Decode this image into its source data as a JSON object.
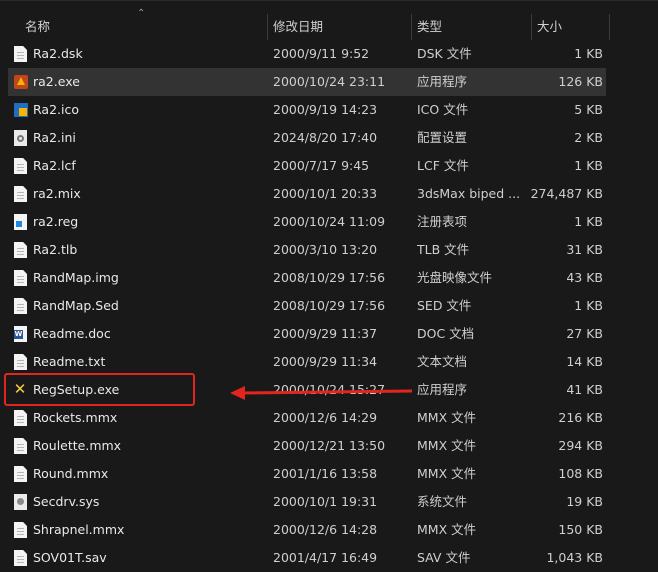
{
  "columns": {
    "name": "名称",
    "date": "修改日期",
    "type": "类型",
    "size": "大小"
  },
  "files": [
    {
      "name": "Ra2.dsk",
      "date": "2000/9/11 9:52",
      "type": "DSK 文件",
      "size": "1 KB",
      "icon": "file-icon"
    },
    {
      "name": "ra2.exe",
      "date": "2000/10/24 23:11",
      "type": "应用程序",
      "size": "126 KB",
      "icon": "ra2-app-icon"
    },
    {
      "name": "Ra2.ico",
      "date": "2000/9/19 14:23",
      "type": "ICO 文件",
      "size": "5 KB",
      "icon": "ico-file-icon"
    },
    {
      "name": "Ra2.ini",
      "date": "2024/8/20 17:40",
      "type": "配置设置",
      "size": "2 KB",
      "icon": "settings-file-icon"
    },
    {
      "name": "Ra2.lcf",
      "date": "2000/7/17 9:45",
      "type": "LCF 文件",
      "size": "1 KB",
      "icon": "file-icon"
    },
    {
      "name": "ra2.mix",
      "date": "2000/10/1 20:33",
      "type": "3dsMax biped ...",
      "size": "274,487 KB",
      "icon": "file-icon"
    },
    {
      "name": "ra2.reg",
      "date": "2000/10/24 11:09",
      "type": "注册表项",
      "size": "1 KB",
      "icon": "registry-file-icon"
    },
    {
      "name": "Ra2.tlb",
      "date": "2000/3/10 13:20",
      "type": "TLB 文件",
      "size": "31 KB",
      "icon": "file-icon"
    },
    {
      "name": "RandMap.img",
      "date": "2008/10/29 17:56",
      "type": "光盘映像文件",
      "size": "43 KB",
      "icon": "file-icon"
    },
    {
      "name": "RandMap.Sed",
      "date": "2008/10/29 17:56",
      "type": "SED 文件",
      "size": "1 KB",
      "icon": "file-icon"
    },
    {
      "name": "Readme.doc",
      "date": "2000/9/29 11:37",
      "type": "DOC 文档",
      "size": "27 KB",
      "icon": "word-doc-icon"
    },
    {
      "name": "Readme.txt",
      "date": "2000/9/29 11:34",
      "type": "文本文档",
      "size": "14 KB",
      "icon": "text-file-icon"
    },
    {
      "name": "RegSetup.exe",
      "date": "2000/10/24 15:27",
      "type": "应用程序",
      "size": "41 KB",
      "icon": "setup-app-icon"
    },
    {
      "name": "Rockets.mmx",
      "date": "2000/12/6 14:29",
      "type": "MMX 文件",
      "size": "216 KB",
      "icon": "file-icon"
    },
    {
      "name": "Roulette.mmx",
      "date": "2000/12/21 13:50",
      "type": "MMX 文件",
      "size": "294 KB",
      "icon": "file-icon"
    },
    {
      "name": "Round.mmx",
      "date": "2001/1/16 13:58",
      "type": "MMX 文件",
      "size": "108 KB",
      "icon": "file-icon"
    },
    {
      "name": "Secdrv.sys",
      "date": "2000/10/1 19:31",
      "type": "系统文件",
      "size": "19 KB",
      "icon": "system-file-icon"
    },
    {
      "name": "Shrapnel.mmx",
      "date": "2000/12/6 14:28",
      "type": "MMX 文件",
      "size": "150 KB",
      "icon": "file-icon"
    },
    {
      "name": "SOV01T.sav",
      "date": "2001/4/17 16:49",
      "type": "SAV 文件",
      "size": "1,043 KB",
      "icon": "file-icon"
    }
  ],
  "selected_file": "ra2.exe",
  "highlighted_file": "RegSetup.exe",
  "colors": {
    "annotation": "#e3251f",
    "background": "#191919",
    "selected_row": "#333333"
  }
}
